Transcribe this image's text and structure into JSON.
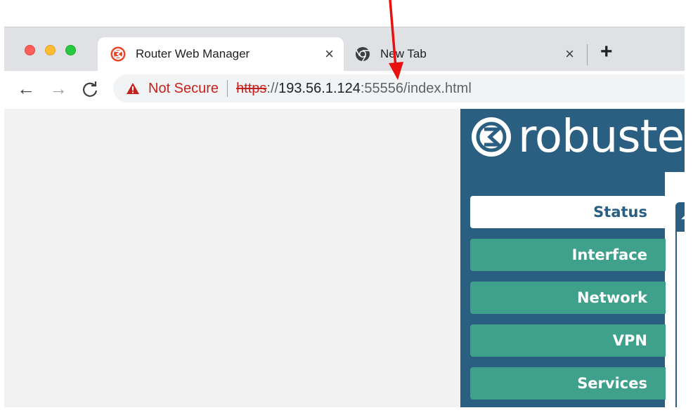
{
  "tabs": [
    {
      "title": "Router Web Manager",
      "favicon": "robustel-logo-icon",
      "close": "×"
    },
    {
      "title": "New Tab",
      "favicon": "chrome-icon",
      "close": "×"
    }
  ],
  "new_tab_label": "+",
  "nav": {
    "back": "←",
    "forward": "→",
    "reload": "C"
  },
  "omnibox": {
    "security_label": "Not Secure",
    "scheme": "https",
    "scheme_sep": "://",
    "host": "193.56.1.124",
    "port_path": ":55556/index.html"
  },
  "router": {
    "brand": "robuste",
    "menu": [
      {
        "label": "Status",
        "active": true
      },
      {
        "label": "Interface",
        "active": false
      },
      {
        "label": "Network",
        "active": false
      },
      {
        "label": "VPN",
        "active": false
      },
      {
        "label": "Services",
        "active": false
      }
    ]
  },
  "colors": {
    "annotation_arrow": "#e8110f",
    "router_blue": "#2b5f82",
    "menu_green": "#3fa18b",
    "warning_red": "#c5221f"
  }
}
